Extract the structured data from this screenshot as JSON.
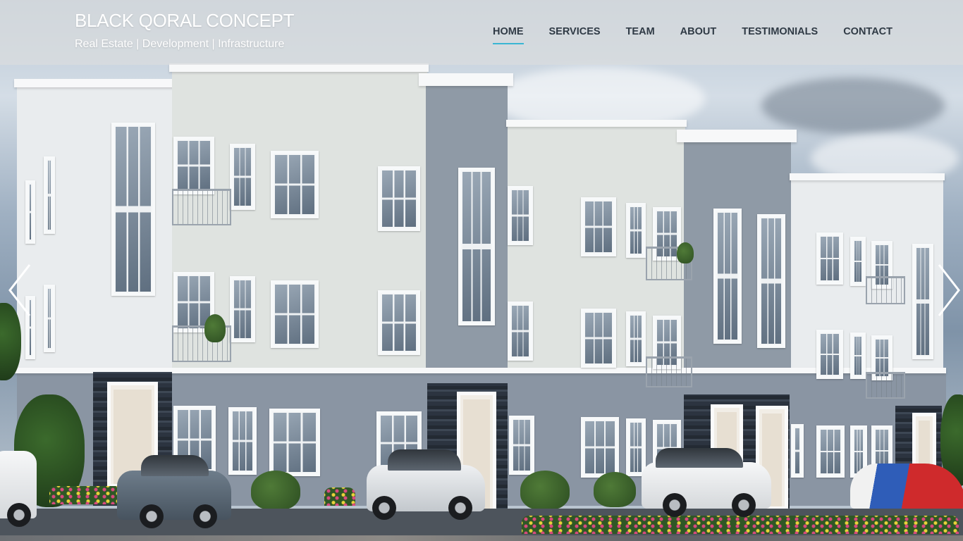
{
  "brand": {
    "title": "BLACK QORAL CONCEPT",
    "tagline": "Real Estate | Development | Infrastructure"
  },
  "nav": {
    "items": [
      {
        "label": "HOME",
        "active": true
      },
      {
        "label": "SERVICES",
        "active": false
      },
      {
        "label": "TEAM",
        "active": false
      },
      {
        "label": "ABOUT",
        "active": false
      },
      {
        "label": "TESTIMONIALS",
        "active": false
      },
      {
        "label": "CONTACT",
        "active": false
      }
    ]
  },
  "slider": {
    "prev_icon": "chevron-left-icon",
    "next_icon": "chevron-right-icon"
  },
  "colors": {
    "header_bg": "#dadcde",
    "nav_text": "#2f3a45",
    "active_underline": "#3ab6d3",
    "brand_text": "#ffffff"
  }
}
